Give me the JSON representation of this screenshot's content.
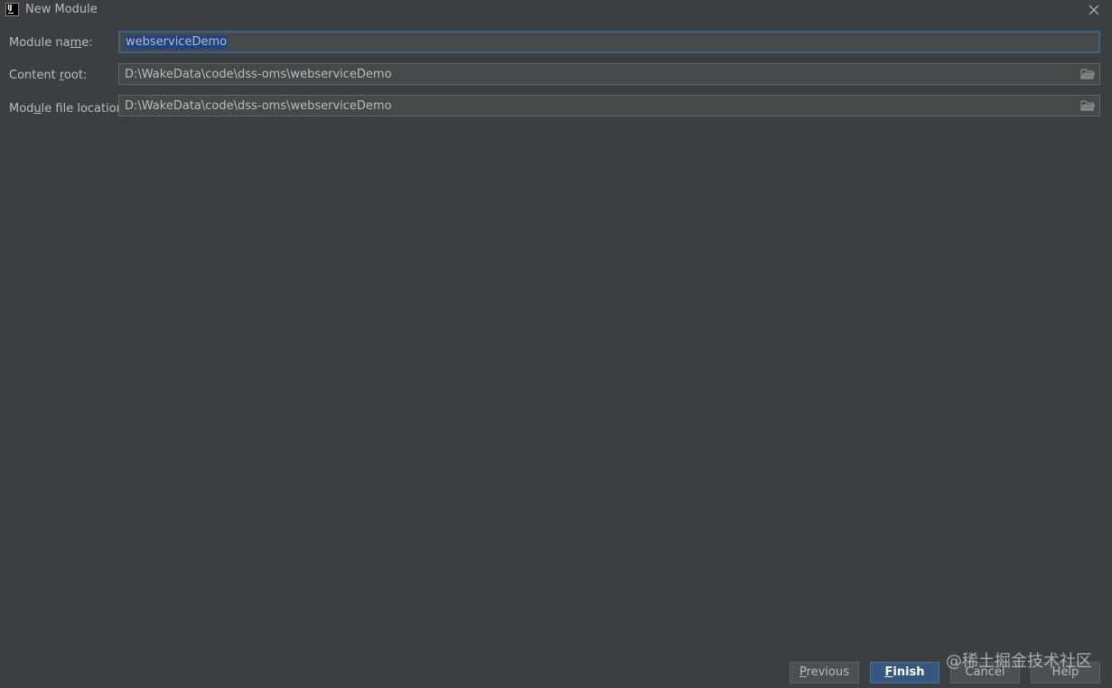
{
  "window": {
    "title": "New Module",
    "app_icon_text": "IJ"
  },
  "form": {
    "module_name": {
      "label_prefix": "Module na",
      "label_mnemonic": "m",
      "label_suffix": "e:",
      "value": "webserviceDemo"
    },
    "content_root": {
      "label_prefix": "Content ",
      "label_mnemonic": "r",
      "label_suffix": "oot:",
      "value": "D:\\WakeData\\code\\dss-oms\\webserviceDemo"
    },
    "module_file_location": {
      "label_prefix": "Mod",
      "label_mnemonic": "u",
      "label_suffix": "le file location:",
      "value": "D:\\WakeData\\code\\dss-oms\\webserviceDemo"
    }
  },
  "buttons": {
    "previous": {
      "mnemonic": "P",
      "rest": "revious"
    },
    "finish": {
      "mnemonic": "F",
      "rest": "inish"
    },
    "cancel": "Cancel",
    "help": "Help"
  },
  "watermark": "@稀土掘金技术社区",
  "colors": {
    "background": "#3c3f41",
    "field_background": "#45494a",
    "focus_border": "#3d6185",
    "selection": "#214283",
    "default_button": "#365880",
    "text": "#bbbbbb"
  },
  "icons": {
    "app": "intellij-icon",
    "close": "close-icon",
    "browse": "folder-icon"
  }
}
